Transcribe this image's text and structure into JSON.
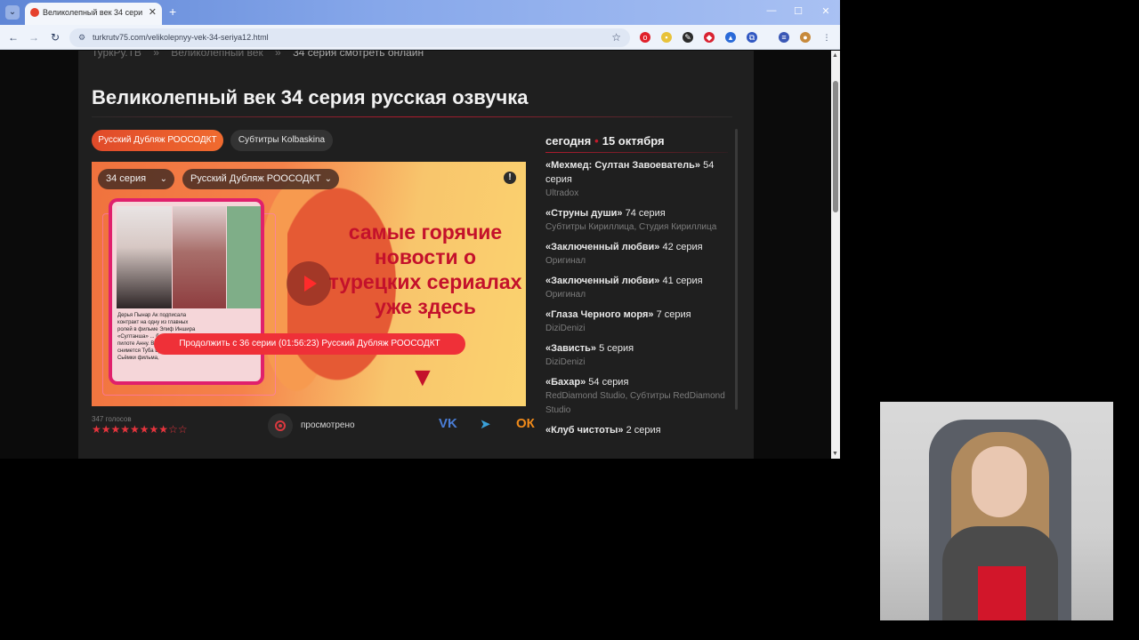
{
  "browser": {
    "tab_title": "Великолепный век 34 серия",
    "tab_close": "✕",
    "new_tab": "+",
    "url": "turkrutv75.com/velikolepnyy-vek-34-seriya12.html",
    "win_minimize": "—",
    "win_maximize": "☐",
    "win_close": "✕"
  },
  "page": {
    "breadcrumbs": [
      "ТуркРу.ТВ",
      "»",
      "Великолепный век",
      "»",
      "34 серия смотреть онлайн"
    ],
    "title": "Великолепный век 34 серия русская озвучка",
    "voice_tabs": [
      "Русский Дубляж РООСОДКТ",
      "Субтитры Kolbaskina"
    ],
    "player": {
      "episode_select": "34 серия",
      "dub_select": "Русский Дубляж РООСОДКТ",
      "info_icon": "!",
      "headline": "самые горячие новости о турецких сериалах уже здесь",
      "phone_text": "Дерья Пынар Ак подписала контракт на одну из главных ролей в фильме Элиф Иншира «Султанша» ... белорусскую ... пилоте Анну. В главной роли снимется Туба Буйюкюстюн Сьёмки фильма,",
      "continue_label": "Продолжить с 36 серии (01:56:23) Русский Дубляж РООСОДКТ"
    },
    "votes": "347 голосов",
    "rating": {
      "value": 8,
      "max": 10,
      "stars": "★★★★★★★★☆☆"
    },
    "watched_label": "просмотрено",
    "share": {
      "vk": "VK",
      "telegram": "➤",
      "ok": "ОК"
    }
  },
  "schedule": {
    "today_label": "сегодня",
    "date": "15 октября",
    "items": [
      {
        "show": "«Мехмед: Султан Завоеватель»",
        "episode": "54 серия",
        "voice": "Ultradox"
      },
      {
        "show": "«Струны души»",
        "episode": "74 серия",
        "voice": "Субтитры Кириллица, Студия Кириллица"
      },
      {
        "show": "«Заключенный любви»",
        "episode": "42 серия",
        "voice": "Оригинал"
      },
      {
        "show": "«Заключенный любви»",
        "episode": "41 серия",
        "voice": "Оригинал"
      },
      {
        "show": "«Глаза Черного моря»",
        "episode": "7 серия",
        "voice": "DiziDenizi"
      },
      {
        "show": "«Зависть»",
        "episode": "5 серия",
        "voice": "DiziDenizi"
      },
      {
        "show": "«Бахар»",
        "episode": "54 серия",
        "voice": "RedDiamond Studio, Субтитры RedDiamond Studio"
      },
      {
        "show": "«Клуб чистоты»",
        "episode": "2 серия",
        "voice": ""
      }
    ]
  },
  "colors": {
    "accent": "#e5343d",
    "background": "#1f1f1f",
    "page_bg": "#0b0b0b"
  }
}
